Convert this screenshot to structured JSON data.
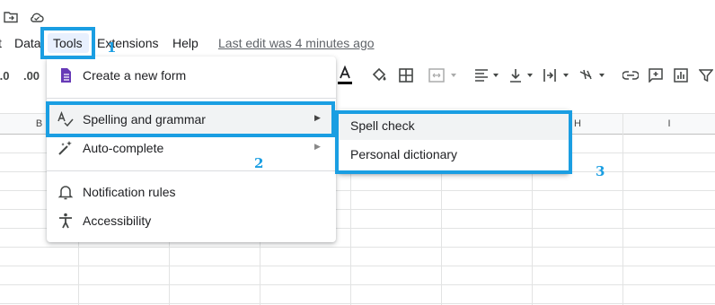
{
  "menubar": {
    "data": "Data",
    "tools": "Tools",
    "extensions": "Extensions",
    "help": "Help",
    "last_edit": "Last edit was 4 minutes ago"
  },
  "toolbar": {
    "decimal_decrease": ".0",
    "decimal_increase": ".00"
  },
  "columns": [
    "B",
    "H",
    "I"
  ],
  "tools_menu": {
    "items": [
      {
        "label": "Create a new form",
        "icon": "form-icon"
      },
      {
        "label": "Spelling and grammar",
        "icon": "spellcheck-icon",
        "has_submenu": true,
        "highlighted": true
      },
      {
        "label": "Auto-complete",
        "icon": "magic-wand-icon",
        "has_submenu": true
      },
      {
        "label": "Notification rules",
        "icon": "bell-icon"
      },
      {
        "label": "Accessibility",
        "icon": "accessibility-icon"
      }
    ]
  },
  "submenu": {
    "items": [
      {
        "label": "Spell check",
        "highlighted": true
      },
      {
        "label": "Personal dictionary"
      }
    ]
  },
  "annotations": {
    "step1": "1",
    "step2": "2",
    "step3": "3",
    "color": "#1a9ee2"
  }
}
